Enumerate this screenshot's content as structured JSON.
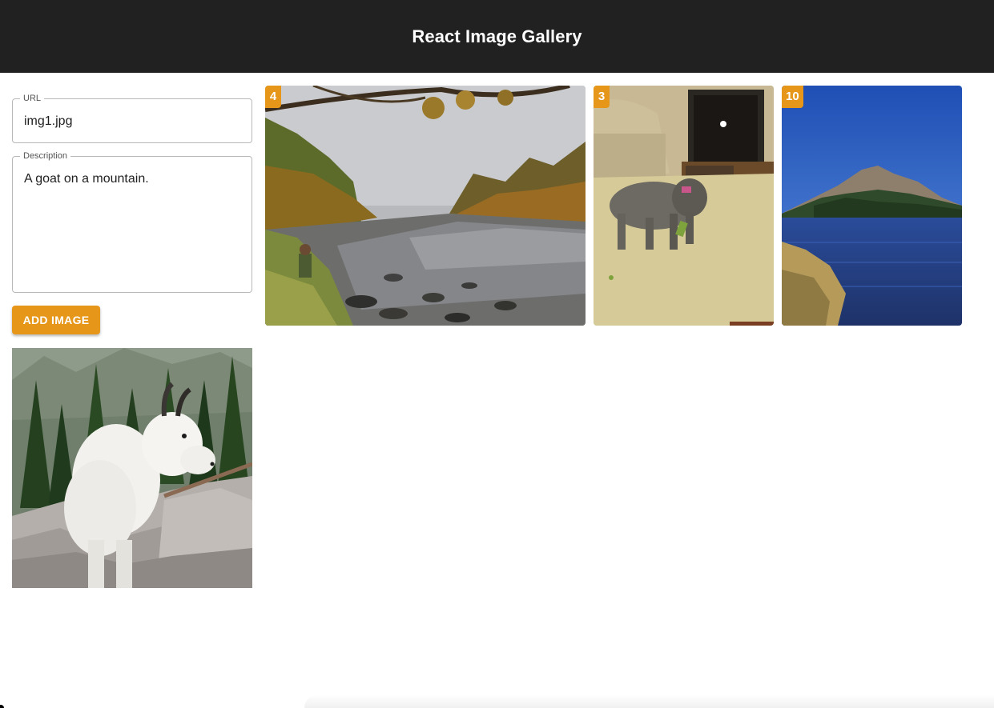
{
  "header": {
    "title": "React Image Gallery"
  },
  "form": {
    "url": {
      "label": "URL",
      "value": "img1.jpg"
    },
    "description": {
      "label": "Description",
      "value": "A goat on a mountain."
    },
    "add_button_label": "ADD IMAGE"
  },
  "preview": {
    "alt": "mountain goat"
  },
  "gallery": [
    {
      "badge": "4",
      "subject": "river in autumn"
    },
    {
      "badge": "3",
      "subject": "dog on carpet"
    },
    {
      "badge": "10",
      "subject": "mountain lake"
    }
  ],
  "colors": {
    "app_bar": "#212121",
    "accent": "#e69618"
  }
}
